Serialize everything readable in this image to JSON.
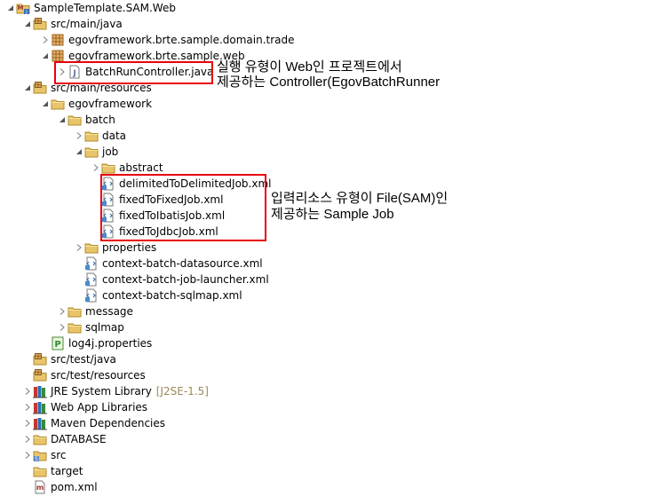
{
  "tree": [
    {
      "label": "SampleTemplate.SAM.Web",
      "icon": "maven-project-icon",
      "twisty": "down"
    },
    {
      "label": "src/main/java",
      "icon": "source-folder-icon",
      "twisty": "down"
    },
    {
      "label": "egovframework.brte.sample.domain.trade",
      "icon": "package-icon",
      "twisty": "right"
    },
    {
      "label": "egovframework.brte.sample.web",
      "icon": "package-icon",
      "twisty": "down"
    },
    {
      "label": "BatchRunController.java",
      "icon": "java-file-icon",
      "twisty": "right"
    },
    {
      "label": "src/main/resources",
      "icon": "source-folder-icon",
      "twisty": "down"
    },
    {
      "label": "egovframework",
      "icon": "folder-icon",
      "twisty": "down"
    },
    {
      "label": "batch",
      "icon": "folder-icon",
      "twisty": "down"
    },
    {
      "label": "data",
      "icon": "folder-icon",
      "twisty": "right"
    },
    {
      "label": "job",
      "icon": "folder-icon",
      "twisty": "down"
    },
    {
      "label": "abstract",
      "icon": "folder-icon",
      "twisty": "right"
    },
    {
      "label": "delimitedToDelimitedJob.xml",
      "icon": "xml-file-icon",
      "twisty": ""
    },
    {
      "label": "fixedToFixedJob.xml",
      "icon": "xml-file-icon",
      "twisty": ""
    },
    {
      "label": "fixedToIbatisJob.xml",
      "icon": "xml-file-icon",
      "twisty": ""
    },
    {
      "label": "fixedToJdbcJob.xml",
      "icon": "xml-file-icon",
      "twisty": ""
    },
    {
      "label": "properties",
      "icon": "folder-icon",
      "twisty": "right"
    },
    {
      "label": "context-batch-datasource.xml",
      "icon": "xml-file-icon",
      "twisty": ""
    },
    {
      "label": "context-batch-job-launcher.xml",
      "icon": "xml-file-icon",
      "twisty": ""
    },
    {
      "label": "context-batch-sqlmap.xml",
      "icon": "xml-file-icon",
      "twisty": ""
    },
    {
      "label": "message",
      "icon": "folder-icon",
      "twisty": "right"
    },
    {
      "label": "sqlmap",
      "icon": "folder-icon",
      "twisty": "right"
    },
    {
      "label": "log4j.properties",
      "icon": "properties-file-icon",
      "twisty": ""
    },
    {
      "label": "src/test/java",
      "icon": "source-folder-icon",
      "twisty": ""
    },
    {
      "label": "src/test/resources",
      "icon": "source-folder-icon",
      "twisty": ""
    },
    {
      "label": "JRE System Library",
      "icon": "library-icon",
      "twisty": "right",
      "decoration": "[J2SE-1.5]"
    },
    {
      "label": "Web App Libraries",
      "icon": "library-icon",
      "twisty": "right"
    },
    {
      "label": "Maven Dependencies",
      "icon": "library-icon",
      "twisty": "right"
    },
    {
      "label": "DATABASE",
      "icon": "folder-icon",
      "twisty": "right"
    },
    {
      "label": "src",
      "icon": "src-folder-icon",
      "twisty": "right"
    },
    {
      "label": "target",
      "icon": "folder-icon",
      "twisty": ""
    },
    {
      "label": "pom.xml",
      "icon": "maven-pom-icon",
      "twisty": ""
    }
  ],
  "annotations": {
    "controller_line1": "실행 유형이 Web인 프로젝트에서",
    "controller_line2": "제공하는 Controller(EgovBatchRunner",
    "jobs_line1": "입력리소스 유형이 File(SAM)인",
    "jobs_line2": "제공하는 Sample Job"
  },
  "colors": {
    "highlight": "#e8000d",
    "decoration": "#9a8a55",
    "folder": "#e8c56a",
    "package": "#c08a3c"
  }
}
